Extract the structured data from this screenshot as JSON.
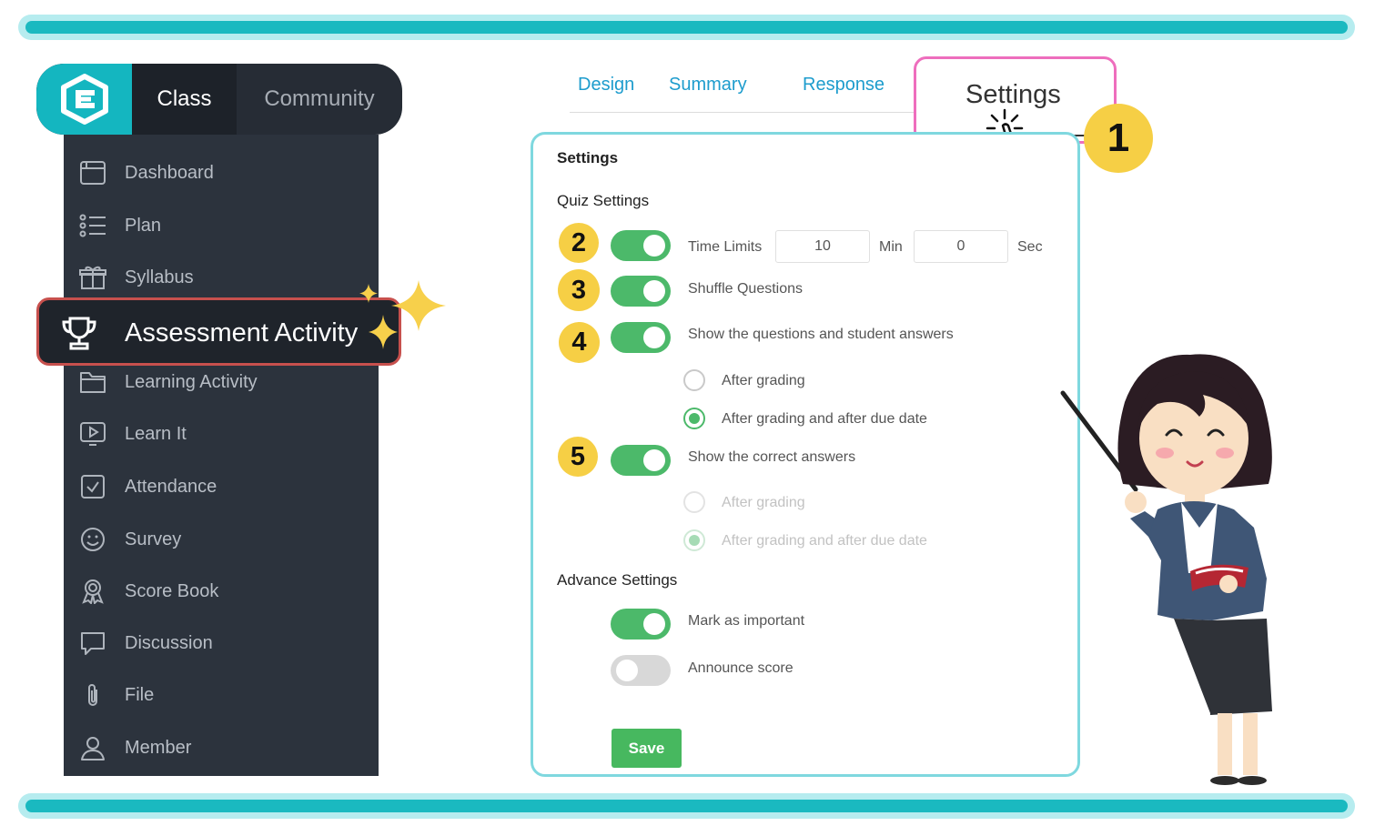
{
  "nav": {
    "class_label": "Class",
    "community_label": "Community"
  },
  "sidebar": {
    "items": [
      {
        "label": "Dashboard",
        "icon": "calendar-icon"
      },
      {
        "label": "Plan",
        "icon": "list-icon"
      },
      {
        "label": "Syllabus",
        "icon": "gift-icon"
      },
      {
        "label": "Assessment Activity",
        "icon": "trophy-icon",
        "active": true
      },
      {
        "label": "Learning Activity",
        "icon": "folder-icon"
      },
      {
        "label": "Learn It",
        "icon": "play-monitor-icon"
      },
      {
        "label": "Attendance",
        "icon": "checkbox-icon"
      },
      {
        "label": "Survey",
        "icon": "smiley-icon"
      },
      {
        "label": "Score Book",
        "icon": "award-icon"
      },
      {
        "label": "Discussion",
        "icon": "chat-icon"
      },
      {
        "label": "File",
        "icon": "paperclip-icon"
      },
      {
        "label": "Member",
        "icon": "user-icon"
      }
    ]
  },
  "tabs": {
    "design": "Design",
    "summary": "Summary",
    "response": "Response",
    "settings": "Settings"
  },
  "steps": {
    "s1": "1",
    "s2": "2",
    "s3": "3",
    "s4": "4",
    "s5": "5"
  },
  "panel": {
    "title": "Settings",
    "quiz_heading": "Quiz Settings",
    "time_limits": {
      "label": "Time Limits",
      "minutes": "10",
      "min_unit": "Min",
      "seconds": "0",
      "sec_unit": "Sec",
      "enabled": true
    },
    "shuffle": {
      "label": "Shuffle Questions",
      "enabled": true
    },
    "show_answers": {
      "label": "Show the questions and student answers",
      "enabled": true,
      "option_after_grading": "After grading",
      "option_after_due": "After grading and after due date",
      "selected": "after_due"
    },
    "show_correct": {
      "label": "Show the correct answers",
      "enabled": true,
      "option_after_grading": "After grading",
      "option_after_due": "After grading and after due date",
      "selected": "after_due"
    },
    "advance_heading": "Advance Settings",
    "mark_important": {
      "label": "Mark as important",
      "enabled": true
    },
    "announce_score": {
      "label": "Announce score",
      "enabled": false
    },
    "save_label": "Save"
  },
  "colors": {
    "accent": "#1ab9c0",
    "toggle_on": "#4cb96a",
    "tab_text": "#1d9ccd",
    "highlight_border": "#ee6ebd",
    "active_border": "#c7504d"
  }
}
